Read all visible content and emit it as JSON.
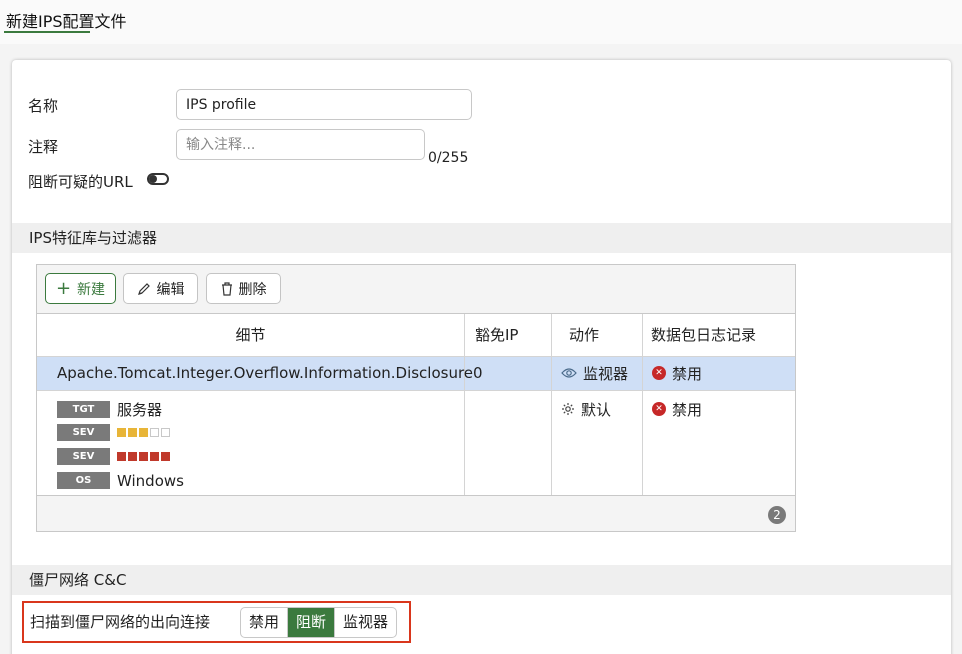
{
  "page": {
    "title": "新建IPS配置文件"
  },
  "form": {
    "name_label": "名称",
    "name_value": "IPS profile",
    "comment_label": "注释",
    "comment_placeholder": "输入注释...",
    "comment_counter": "0/255",
    "block_url_label": "阻断可疑的URL",
    "block_url_enabled": false
  },
  "signatures": {
    "section_title": "IPS特征库与过滤器",
    "toolbar": {
      "new_label": "新建",
      "edit_label": "编辑",
      "delete_label": "删除"
    },
    "columns": [
      "细节",
      "豁免IP",
      "动作",
      "数据包日志记录"
    ],
    "rows": [
      {
        "detail": "Apache.Tomcat.Integer.Overflow.Information.Disclosure",
        "exempt_ip": "0",
        "action": "监视器",
        "action_icon": "eye-icon",
        "packet_log": "禁用",
        "selected": true
      },
      {
        "filters": [
          {
            "tag": "TGT",
            "value": "服务器"
          },
          {
            "tag": "SEV",
            "level": 3,
            "max": 5,
            "color": "#e8b538"
          },
          {
            "tag": "SEV",
            "level": 5,
            "max": 5,
            "color": "#c0392b"
          },
          {
            "tag": "OS",
            "value": "Windows"
          }
        ],
        "exempt_ip": "",
        "action": "默认",
        "action_icon": "gear-icon",
        "packet_log": "禁用",
        "selected": false
      }
    ],
    "count": "2"
  },
  "botnet": {
    "section_title": "僵尸网络 C&C",
    "scan_label": "扫描到僵尸网络的出向连接",
    "options": [
      "禁用",
      "阻断",
      "监视器"
    ],
    "selected": "阻断"
  },
  "colors": {
    "accent": "#3b7a3e",
    "selected_row": "#cfdff6",
    "danger": "#c62828",
    "highlight_border": "#d9361c"
  }
}
